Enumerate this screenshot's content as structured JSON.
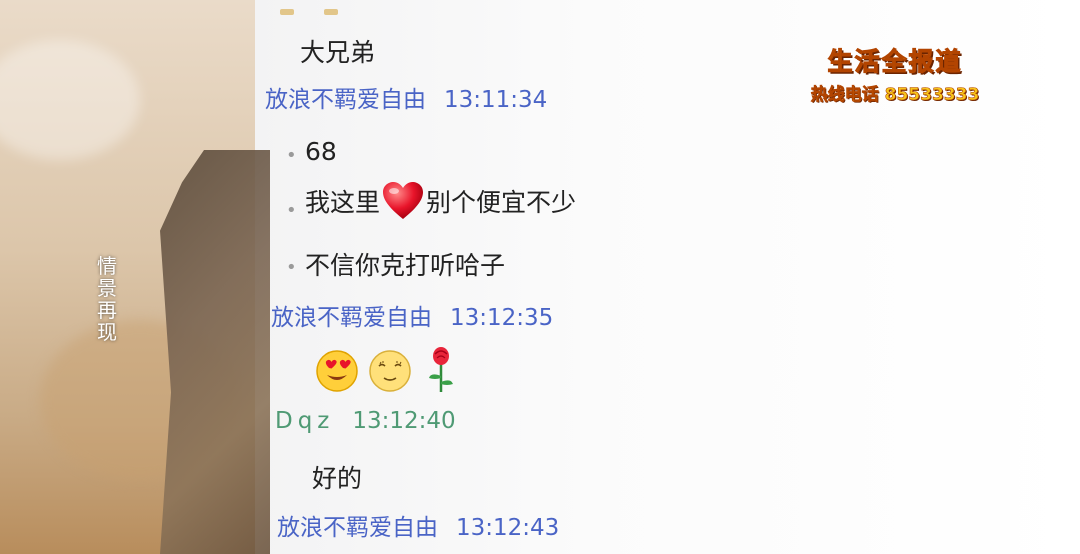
{
  "overlay": {
    "vertical_caption": "情景再现",
    "logo_title": "生活全报道",
    "hotline_label": "热线电话",
    "hotline_number": "85533333"
  },
  "chat": {
    "messages": [
      {
        "type": "text",
        "text": "大兄弟"
      },
      {
        "type": "sender",
        "name": "放浪不羁爱自由",
        "time": "13:11:34",
        "color": "#4a64c6"
      },
      {
        "type": "text",
        "text": "68"
      },
      {
        "type": "text_with_icon",
        "before": "我这里",
        "icon": "heart-icon",
        "after": "别个便宜不少"
      },
      {
        "type": "text",
        "text": "不信你克打听哈子"
      },
      {
        "type": "sender",
        "name": "放浪不羁爱自由",
        "time": "13:12:35",
        "color": "#4a64c6"
      },
      {
        "type": "emoji_row",
        "icons": [
          "heart-eyes-emoji-icon",
          "grimace-emoji-icon",
          "rose-icon"
        ]
      },
      {
        "type": "sender",
        "name": "Dqz",
        "time": "13:12:40",
        "color": "#4f9a74"
      },
      {
        "type": "text",
        "text": "好的"
      },
      {
        "type": "sender",
        "name": "放浪不羁爱自由",
        "time": "13:12:43",
        "color": "#4a64c6"
      }
    ]
  },
  "colors": {
    "sender_blue": "#4a64c6",
    "sender_green": "#4f9a74",
    "logo_yellow": "#f7c51b"
  }
}
